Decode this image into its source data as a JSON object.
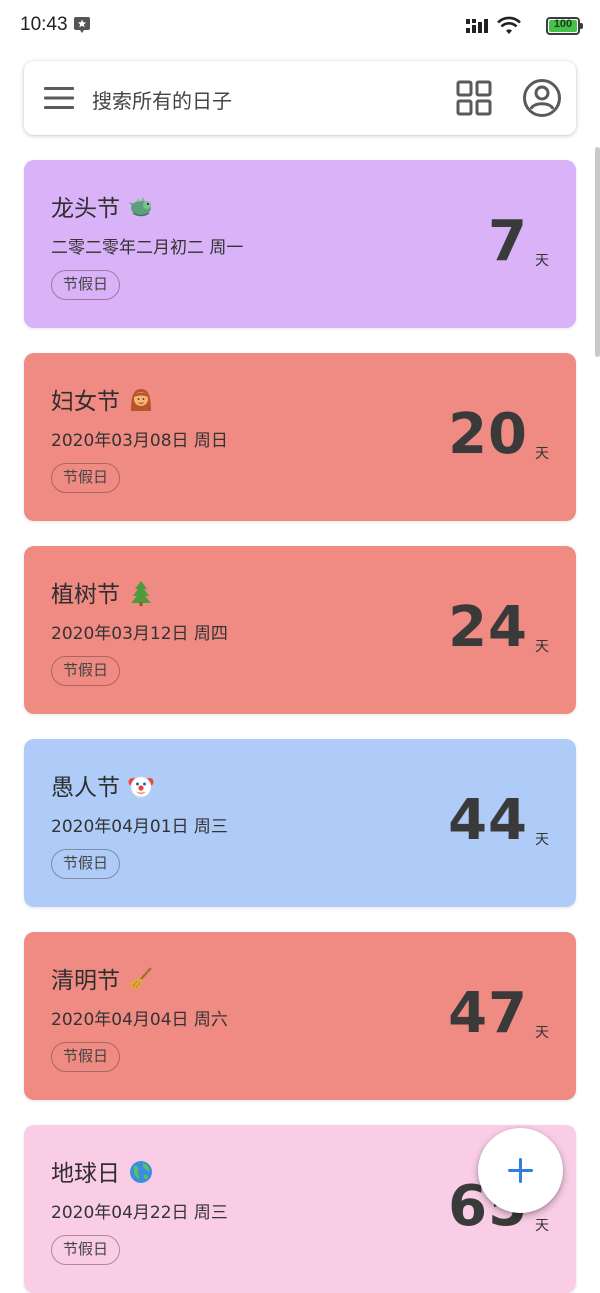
{
  "status_bar": {
    "time": "10:43",
    "battery": "100",
    "battery_level": 1.0,
    "icons": [
      "app-notification-icon",
      "signal-icon",
      "wifi-icon",
      "battery-icon"
    ]
  },
  "search": {
    "placeholder": "搜索所有的日子",
    "icons": [
      "menu-icon",
      "grid-view-icon",
      "account-icon"
    ]
  },
  "cards": [
    {
      "title": "龙头节",
      "emoji": "dragon-icon",
      "date": "二零二零年二月初二 周一",
      "tag": "节假日",
      "days": "7",
      "unit": "天",
      "color": "#d9b2f7"
    },
    {
      "title": "妇女节",
      "emoji": "woman-icon",
      "date": "2020年03月08日 周日",
      "tag": "节假日",
      "days": "20",
      "unit": "天",
      "color": "#f08b83"
    },
    {
      "title": "植树节",
      "emoji": "tree-icon",
      "date": "2020年03月12日 周四",
      "tag": "节假日",
      "days": "24",
      "unit": "天",
      "color": "#f08b83"
    },
    {
      "title": "愚人节",
      "emoji": "clown-icon",
      "date": "2020年04月01日 周三",
      "tag": "节假日",
      "days": "44",
      "unit": "天",
      "color": "#aeccf7"
    },
    {
      "title": "清明节",
      "emoji": "broom-icon",
      "date": "2020年04月04日 周六",
      "tag": "节假日",
      "days": "47",
      "unit": "天",
      "color": "#f08b83"
    },
    {
      "title": "地球日",
      "emoji": "globe-icon",
      "date": "2020年04月22日 周三",
      "tag": "节假日",
      "days": "65",
      "unit": "天",
      "color": "#f9cde6"
    }
  ],
  "fab": {
    "icon": "plus-icon",
    "color": "#2f7fe0"
  }
}
